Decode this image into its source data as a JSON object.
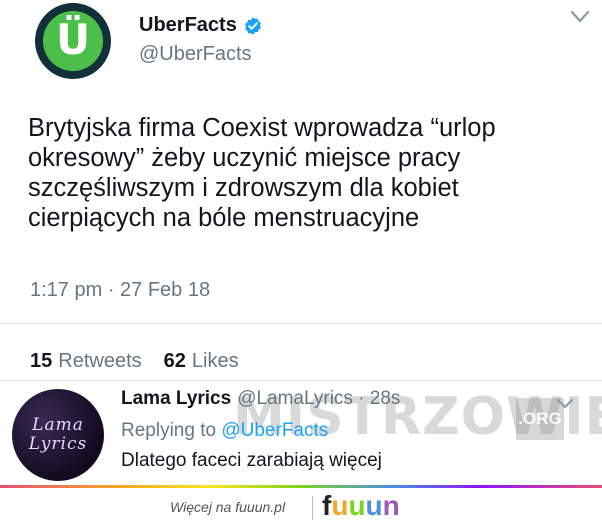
{
  "tweet": {
    "author": {
      "display_name": "UberFacts",
      "handle": "@UberFacts",
      "avatar_glyph": "Ü",
      "verified": true,
      "avatar_colors": {
        "outer": "#12303a",
        "inner": "#4cbf4a"
      }
    },
    "text": "Brytyjska firma Coexist wprowadza “urlop\nokresowy” żeby uczynić miejsce pracy\nszczęśliwszym i zdrowszym dla kobiet\ncierpiących na bóle menstruacyjne",
    "timestamp": "1:17 pm · 27 Feb 18",
    "stats": {
      "retweets_count": "15",
      "retweets_label": "Retweets",
      "likes_count": "62",
      "likes_label": "Likes"
    }
  },
  "reply": {
    "display_name": "Lama Lyrics",
    "handle_time": "@LamaLyrics · 28s",
    "avatar_line1": "Lama",
    "avatar_line2": "Lyrics",
    "replying_prefix": "Replying to",
    "replying_mention": "@UberFacts",
    "text": "Dlatego faceci zarabiają więcej"
  },
  "watermark": {
    "text": "MISTRZOWIE",
    "suffix": ".ORG"
  },
  "footer": {
    "link_text": "Więcej na fuuun.pl",
    "brand_letters": [
      {
        "letter": "f",
        "color": "#222222"
      },
      {
        "letter": "u",
        "color": "#f5a623"
      },
      {
        "letter": "u",
        "color": "#7ed321"
      },
      {
        "letter": "u",
        "color": "#4a90e2"
      },
      {
        "letter": "n",
        "color": "#9b59b6"
      }
    ]
  },
  "colors": {
    "accent_link": "#1da1f2",
    "verified_badge": "#1da1f2",
    "muted_text": "#657786",
    "primary_text": "#14171a"
  }
}
